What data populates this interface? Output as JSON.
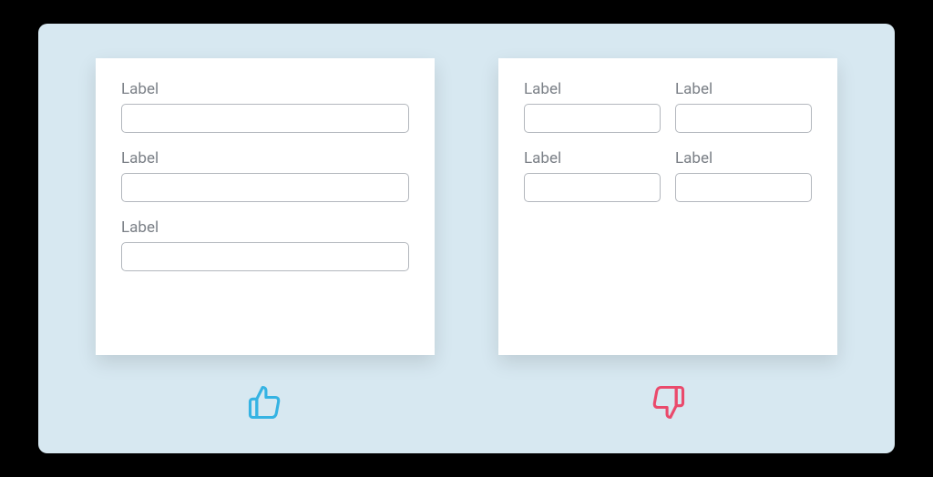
{
  "colors": {
    "background": "#d7e8f1",
    "card": "#ffffff",
    "labelText": "#7a7f86",
    "inputBorder": "#b3b7bd",
    "thumbsUp": "#35b3e3",
    "thumbsDown": "#ea4a6c"
  },
  "good": {
    "fields": [
      {
        "label": "Label"
      },
      {
        "label": "Label"
      },
      {
        "label": "Label"
      }
    ],
    "iconName": "thumbs-up-icon"
  },
  "bad": {
    "fields": [
      {
        "label": "Label"
      },
      {
        "label": "Label"
      },
      {
        "label": "Label"
      },
      {
        "label": "Label"
      }
    ],
    "iconName": "thumbs-down-icon"
  }
}
